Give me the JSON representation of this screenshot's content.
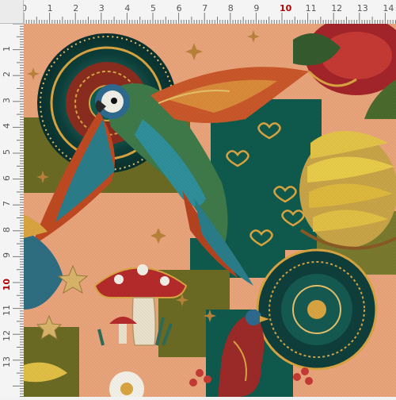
{
  "ruler": {
    "top_labels": [
      "0",
      "1",
      "2",
      "3",
      "4",
      "5",
      "6",
      "7",
      "8",
      "9",
      "10",
      "11",
      "12",
      "13",
      "14"
    ],
    "left_labels": [
      "1",
      "2",
      "3",
      "4",
      "5",
      "6",
      "7",
      "8",
      "9",
      "10",
      "11",
      "12",
      "13"
    ],
    "highlight_label": "10",
    "highlight_color": "#b00000"
  },
  "fabric": {
    "background_color": "#e9a47b",
    "block_colors": [
      "#6b6b24",
      "#0f5a4d",
      "#7a7a2e"
    ],
    "motifs": [
      "macaw-parrot",
      "mandala-medallion",
      "mushroom",
      "banana-bunch",
      "heart",
      "star",
      "flower",
      "red-bird"
    ]
  }
}
